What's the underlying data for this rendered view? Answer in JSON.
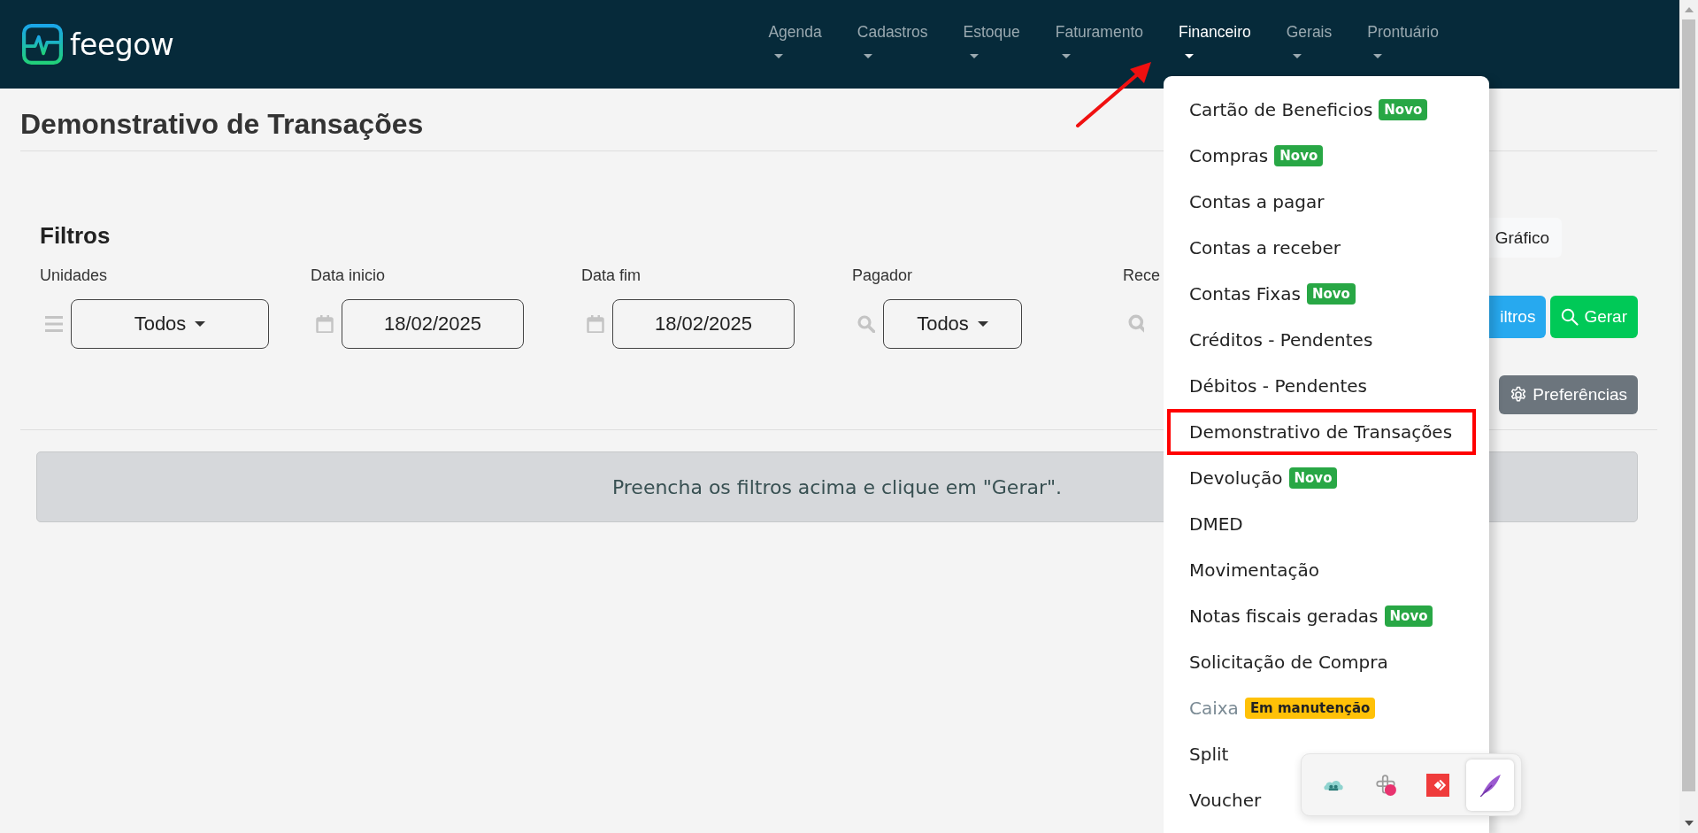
{
  "header": {
    "logo": "feegow",
    "nav": [
      {
        "label": "Agenda",
        "selected": false
      },
      {
        "label": "Cadastros",
        "selected": false
      },
      {
        "label": "Estoque",
        "selected": false
      },
      {
        "label": "Faturamento",
        "selected": false
      },
      {
        "label": "Financeiro",
        "selected": true
      },
      {
        "label": "Gerais",
        "selected": false
      },
      {
        "label": "Prontuário",
        "selected": false
      }
    ]
  },
  "page": {
    "title": "Demonstrativo de Transações"
  },
  "filters": {
    "title": "Filtros",
    "fields": [
      {
        "label": "Unidades",
        "kind": "select",
        "value": "Todos"
      },
      {
        "label": "Data inicio",
        "kind": "date",
        "value": "18/02/2025"
      },
      {
        "label": "Data fim",
        "kind": "date",
        "value": "18/02/2025"
      },
      {
        "label": "Pagador",
        "kind": "search-select",
        "value": "Todos"
      },
      {
        "label": "Rece",
        "kind": "partial"
      }
    ]
  },
  "actions": {
    "rows": [
      {
        "buttons": [
          {
            "label": "Gráfico",
            "kind": "light"
          }
        ]
      },
      {
        "buttons": [
          {
            "label": "iltros",
            "kind": "info"
          },
          {
            "label": "Gerar",
            "kind": "success"
          }
        ]
      },
      {
        "buttons": [
          {
            "label": "Preferências",
            "kind": "secondary"
          }
        ]
      }
    ]
  },
  "alert": "Preencha os filtros acima e clique em \"Gerar\".",
  "menu": {
    "items": [
      {
        "label": "Cartão de Beneficios",
        "badge": {
          "text": "Novo",
          "color": "#28a745"
        },
        "disabled": false,
        "highlighted": false
      },
      {
        "label": "Compras",
        "badge": {
          "text": "Novo",
          "color": "#28a745"
        },
        "disabled": false,
        "highlighted": false
      },
      {
        "label": "Contas a pagar",
        "disabled": false,
        "highlighted": false
      },
      {
        "label": "Contas a receber",
        "disabled": false,
        "highlighted": false
      },
      {
        "label": "Contas Fixas",
        "badge": {
          "text": "Novo",
          "color": "#28a745"
        },
        "disabled": false,
        "highlighted": false
      },
      {
        "label": "Créditos - Pendentes",
        "disabled": false,
        "highlighted": false
      },
      {
        "label": "Débitos - Pendentes",
        "disabled": false,
        "highlighted": false
      },
      {
        "label": "Demonstrativo de Transações",
        "disabled": false,
        "highlighted": true
      },
      {
        "label": "Devolução",
        "badge": {
          "text": "Novo",
          "color": "#28a745"
        },
        "disabled": false,
        "highlighted": false
      },
      {
        "label": "DMED",
        "disabled": false,
        "highlighted": false
      },
      {
        "label": "Movimentação",
        "disabled": false,
        "highlighted": false
      },
      {
        "label": "Notas fiscais geradas",
        "badge": {
          "text": "Novo",
          "color": "#28a745"
        },
        "disabled": false,
        "highlighted": false
      },
      {
        "label": "Solicitação de Compra",
        "disabled": false,
        "highlighted": false
      },
      {
        "label": "Caixa",
        "badge": {
          "text": "Em manutenção",
          "color": "#ffc107"
        },
        "disabled": true,
        "highlighted": false
      },
      {
        "label": "Split",
        "disabled": false,
        "highlighted": false
      },
      {
        "label": "Voucher",
        "disabled": false,
        "highlighted": false
      }
    ]
  },
  "toolbar": {
    "items": [
      {
        "kind": "cloud",
        "selected": false
      },
      {
        "kind": "knot",
        "selected": false
      },
      {
        "kind": "diamond",
        "selected": false
      },
      {
        "kind": "feather",
        "selected": true
      }
    ]
  }
}
